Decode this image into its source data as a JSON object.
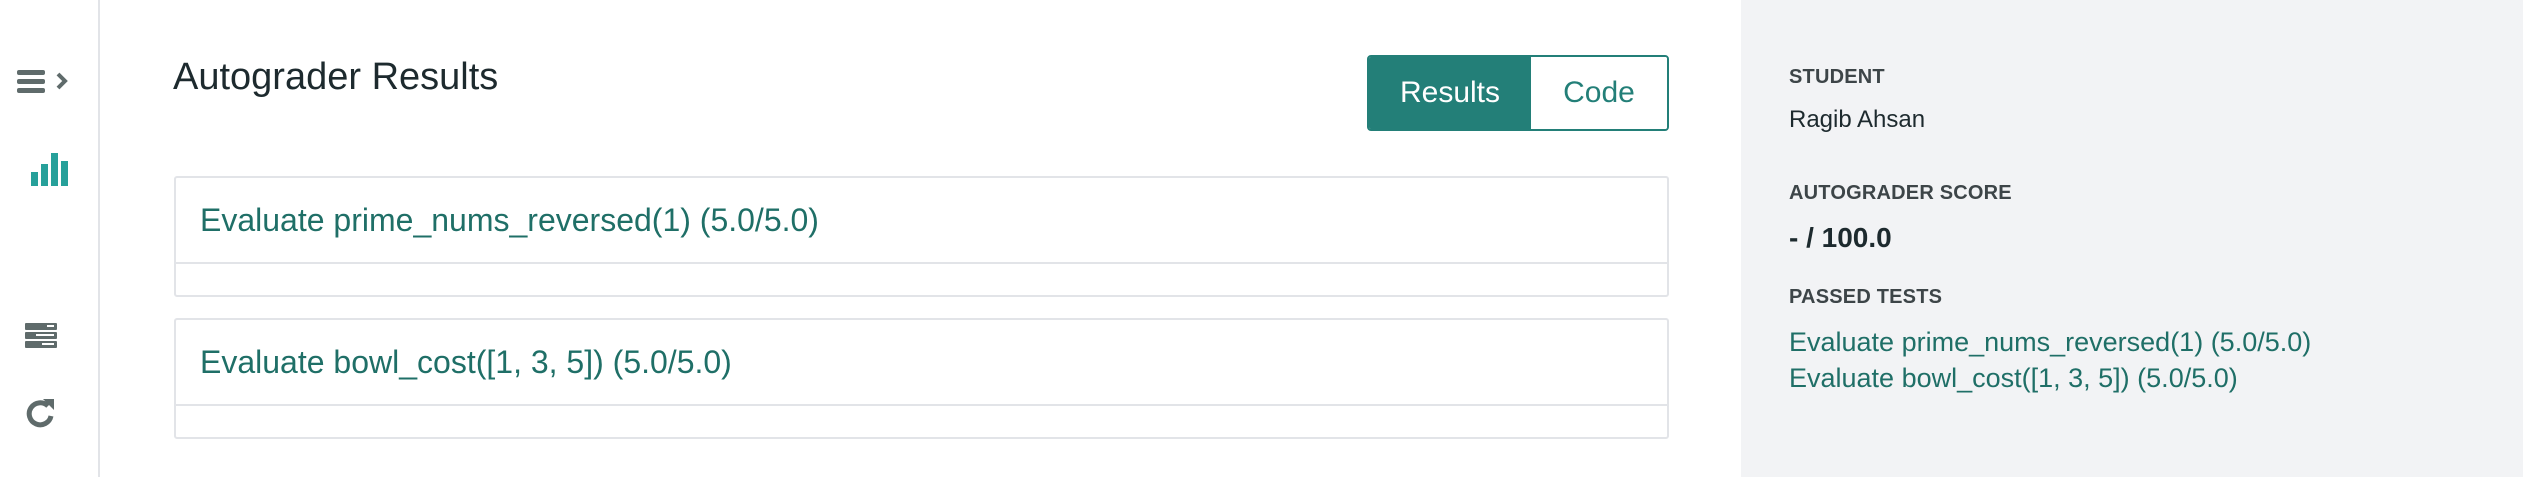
{
  "header": {
    "title": "Autograder Results"
  },
  "view_toggle": {
    "results_label": "Results",
    "code_label": "Code",
    "active": "Results"
  },
  "tests": [
    {
      "title": "Evaluate prime_nums_reversed(1) (5.0/5.0)"
    },
    {
      "title": "Evaluate bowl_cost([1, 3, 5]) (5.0/5.0)"
    }
  ],
  "side": {
    "student_label": "STUDENT",
    "student_name": "Ragib Ahsan",
    "score_label": "AUTOGRADER SCORE",
    "score_value": "- / 100.0",
    "passed_label": "PASSED TESTS",
    "passed": [
      "Evaluate prime_nums_reversed(1) (5.0/5.0)",
      "Evaluate bowl_cost([1, 3, 5]) (5.0/5.0)"
    ]
  },
  "colors": {
    "accent": "#237f78",
    "link": "#1f6f67",
    "panel": "#f2f3f5"
  },
  "icons": [
    "menu-expand-icon",
    "bar-chart-icon",
    "server-icon",
    "refresh-icon"
  ]
}
